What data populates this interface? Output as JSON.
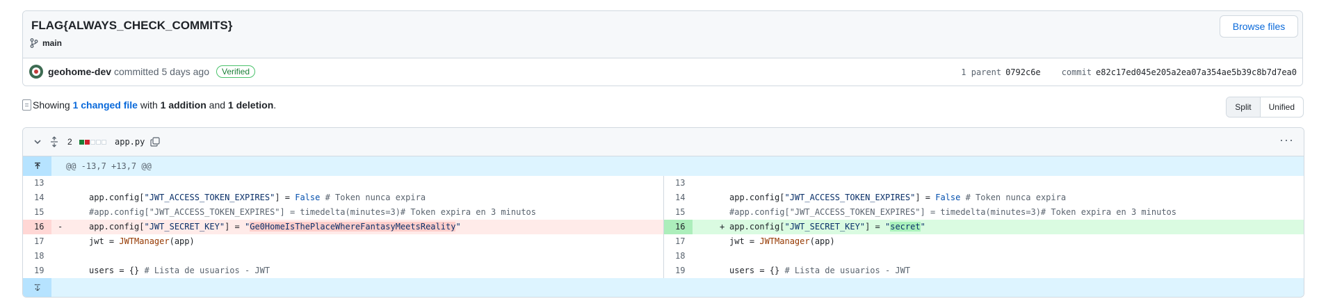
{
  "commit": {
    "title": "FLAG{ALWAYS_CHECK_COMMITS}",
    "branch": "main",
    "browse_label": "Browse files",
    "author": "geohome-dev",
    "committed_text": "committed 5 days ago",
    "verified_label": "Verified",
    "parent_label": "1 parent",
    "parent_sha": "0792c6e",
    "commit_label": "commit",
    "commit_sha": "e82c17ed045e205a2ea07a354ae5b39c8b7d7ea0"
  },
  "summary": {
    "showing": "Showing",
    "changed_files": "1 changed file",
    "with": "with",
    "additions": "1 addition",
    "and": "and",
    "deletions": "1 deletion",
    "end": "."
  },
  "view_toggle": {
    "split": "Split",
    "unified": "Unified",
    "selected": "Split"
  },
  "file": {
    "changes": "2",
    "name": "app.py",
    "hunk_header": "@@ -13,7 +13,7 @@",
    "icons": {
      "collapse": "chevron-down-icon",
      "expand": "unfold-icon",
      "copy": "copy-icon",
      "menu": "kebab-horizontal-icon"
    },
    "lines": {
      "l13": "13",
      "l14": "14",
      "l15": "15",
      "l16": "16",
      "l17": "17",
      "l18": "18",
      "l19": "19",
      "code14a": "app.config[",
      "code14b": "\"JWT_ACCESS_TOKEN_EXPIRES\"",
      "code14c": "] = ",
      "code14d": "False",
      "code14e": " # Token nunca expira",
      "code15": "#app.config[\"JWT_ACCESS_TOKEN_EXPIRES\"] = timedelta(minutes=3)# Token expira en 3 minutos",
      "code16_del_a": "app.config[",
      "code16_key": "\"JWT_SECRET_KEY\"",
      "code16_mid": "] = ",
      "code16_del_q1": "\"",
      "code16_del_val": "Ge0HomeIsThePlaceWhereFantasyMeetsReality",
      "code16_del_q2": "\"",
      "code16_add_val": "secret",
      "code17a": "jwt = ",
      "code17b": "JWTManager",
      "code17c": "(app)",
      "code19a": "users = {} ",
      "code19b": "# Lista de usuarios - JWT",
      "minus": "-",
      "plus": "+"
    }
  },
  "colors": {
    "accent": "#0969da",
    "deletion": "#ffebe9",
    "addition": "#dafbe1",
    "hunk": "#ddf4ff"
  }
}
